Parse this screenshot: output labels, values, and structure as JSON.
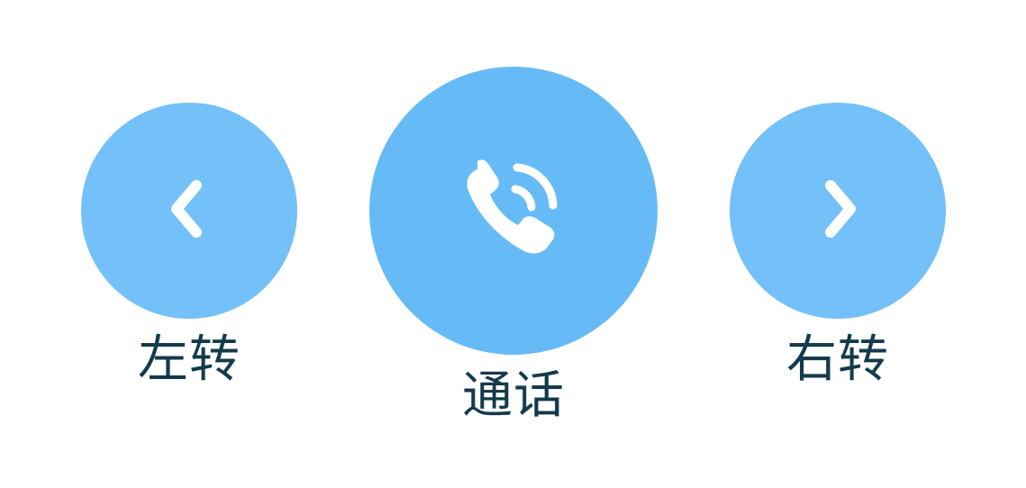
{
  "controls": {
    "left": {
      "label": "左转",
      "icon": "chevron-left-icon"
    },
    "call": {
      "label": "通话",
      "icon": "phone-call-icon"
    },
    "right": {
      "label": "右转",
      "icon": "chevron-right-icon"
    }
  },
  "colors": {
    "side_button": "#74c0f8",
    "call_button": "#66bbf7",
    "icon": "#ffffff",
    "label_text": "#143a4d",
    "background": "#ffffff"
  }
}
